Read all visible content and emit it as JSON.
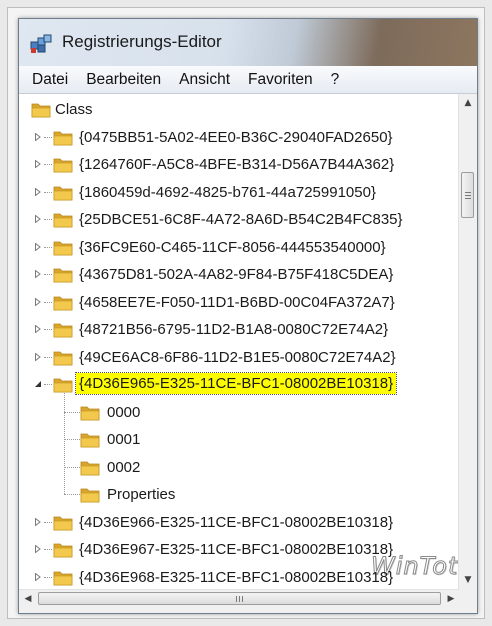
{
  "window": {
    "title": "Registrierungs-Editor",
    "icon": "regedit-icon"
  },
  "menu": [
    "Datei",
    "Bearbeiten",
    "Ansicht",
    "Favoriten",
    "?"
  ],
  "tree": {
    "root": "Class",
    "items": [
      {
        "label": "{0475BB51-5A02-4EE0-B36C-29040FAD2650}",
        "expanded": false
      },
      {
        "label": "{1264760F-A5C8-4BFE-B314-D56A7B44A362}",
        "expanded": false
      },
      {
        "label": "{1860459d-4692-4825-b761-44a725991050}",
        "expanded": false
      },
      {
        "label": "{25DBCE51-6C8F-4A72-8A6D-B54C2B4FC835}",
        "expanded": false
      },
      {
        "label": "{36FC9E60-C465-11CF-8056-444553540000}",
        "expanded": false
      },
      {
        "label": "{43675D81-502A-4A82-9F84-B75F418C5DEA}",
        "expanded": false
      },
      {
        "label": "{4658EE7E-F050-11D1-B6BD-00C04FA372A7}",
        "expanded": false
      },
      {
        "label": "{48721B56-6795-11D2-B1A8-0080C72E74A2}",
        "expanded": false
      },
      {
        "label": "{49CE6AC8-6F86-11D2-B1E5-0080C72E74A2}",
        "expanded": false
      },
      {
        "label": "{4D36E965-E325-11CE-BFC1-08002BE10318}",
        "expanded": true,
        "selected": true
      },
      {
        "label": "{4D36E966-E325-11CE-BFC1-08002BE10318}",
        "expanded": false
      },
      {
        "label": "{4D36E967-E325-11CE-BFC1-08002BE10318}",
        "expanded": false
      },
      {
        "label": "{4D36E968-E325-11CE-BFC1-08002BE10318}",
        "expanded": false
      }
    ],
    "children": [
      "0000",
      "0001",
      "0002",
      "Properties"
    ]
  },
  "watermark": "WinTotal",
  "colors": {
    "selection_highlight": "#fefe00",
    "folder": "#e8b93a"
  }
}
